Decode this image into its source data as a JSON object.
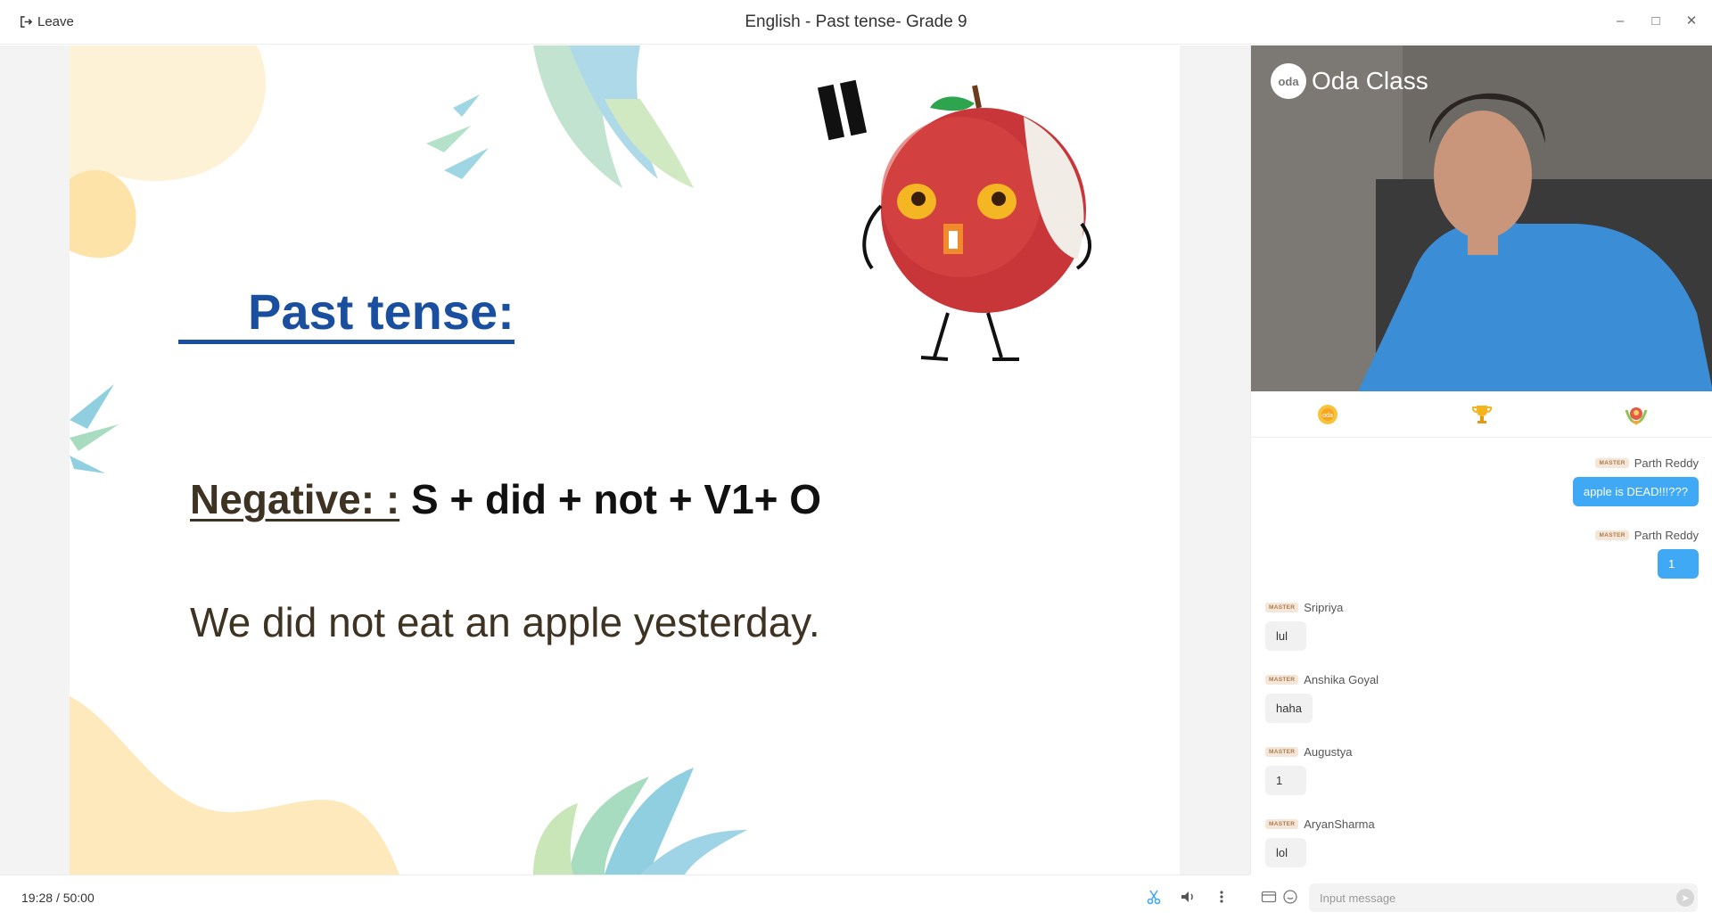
{
  "window": {
    "title": "English - Past tense- Grade 9",
    "leave_label": "Leave"
  },
  "slide": {
    "title": "Past tense:",
    "rule_label": "Negative: :",
    "rule_formula": " S + did + not + V1+ O",
    "example": "We did not eat an apple yesterday."
  },
  "video": {
    "brand_mark": "oda",
    "brand_name": "Oda Class"
  },
  "tabs": [
    {
      "icon": "coin-icon"
    },
    {
      "icon": "trophy-icon"
    },
    {
      "icon": "medal-icon"
    }
  ],
  "chat": {
    "messages": [
      {
        "sender": "Parth Reddy",
        "badge": "MASTER",
        "text": "apple is DEAD!!!???",
        "side": "right"
      },
      {
        "sender": "Parth Reddy",
        "badge": "MASTER",
        "text": "1",
        "side": "right"
      },
      {
        "sender": "Sripriya",
        "badge": "MASTER",
        "text": "lul",
        "side": "left"
      },
      {
        "sender": "Anshika Goyal",
        "badge": "MASTER",
        "text": "haha",
        "side": "left"
      },
      {
        "sender": "Augustya",
        "badge": "MASTER",
        "text": "1",
        "side": "left"
      },
      {
        "sender": "AryanSharma",
        "badge": "MASTER",
        "text": "lol",
        "side": "left"
      }
    ],
    "input_placeholder": "Input message"
  },
  "playback": {
    "elapsed": "19:28",
    "separator": "/",
    "total": "50:00"
  },
  "colors": {
    "title_blue": "#1a4fa0",
    "chat_bubble_blue": "#3fa9f5",
    "text_brown": "#3e3222"
  }
}
